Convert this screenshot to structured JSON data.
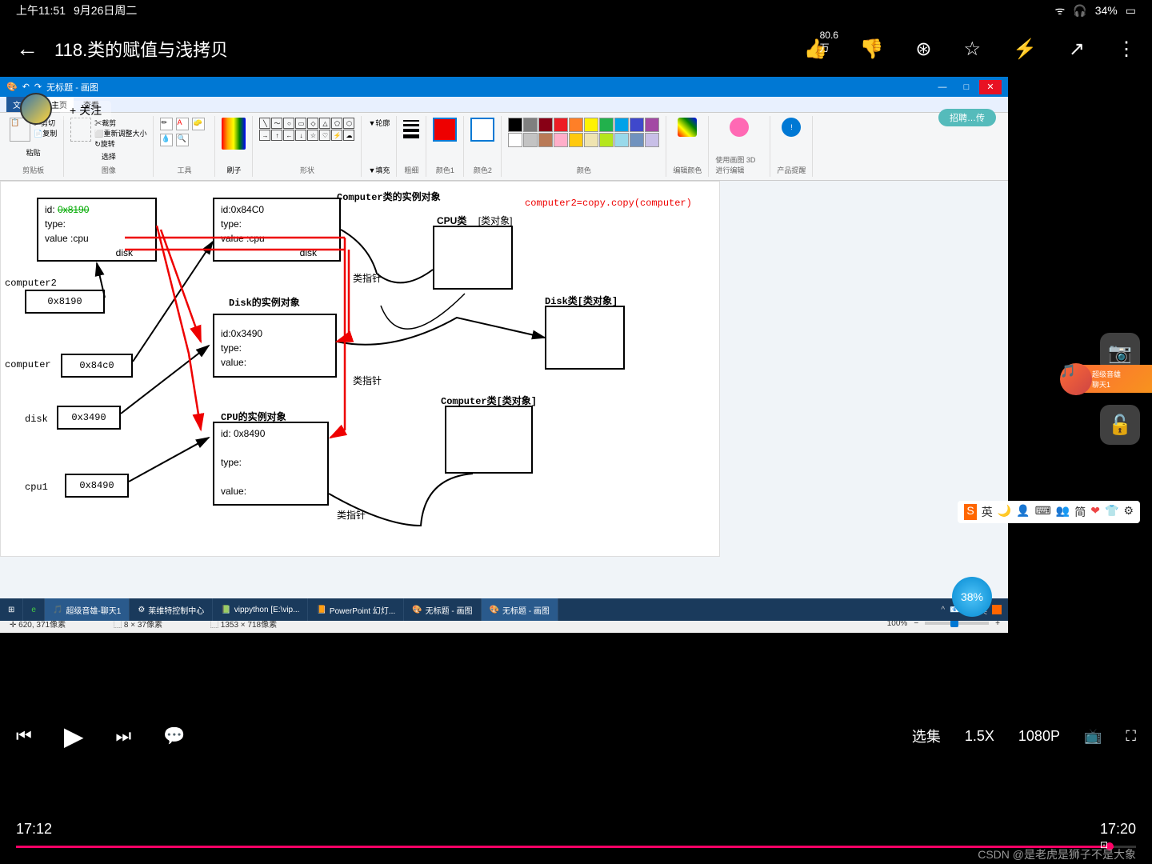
{
  "status": {
    "time": "上午11:51",
    "date": "9月26日周二",
    "battery": "34%"
  },
  "nav": {
    "title": "118.类的赋值与浅拷贝",
    "like_count": "80.6万"
  },
  "paint": {
    "window_title": "无标题 - 画图",
    "menu_file": "文件",
    "menu_home": "主页",
    "menu_view": "查看",
    "follow": "+ 关注",
    "user_badge": "招聘…传",
    "clipboard": "剪贴板",
    "paste": "粘贴",
    "cut": "剪切",
    "copy": "复制",
    "image": "图像",
    "select": "选择",
    "rotate": "旋转",
    "crop": "裁剪",
    "resize": "重新调整大小",
    "tools": "工具",
    "brush": "刷子",
    "shapes": "形状",
    "outline": "轮廓",
    "fill": "填充",
    "thickness": "粗细",
    "color1": "颜色1",
    "color2": "颜色2",
    "colors": "颜色",
    "edit_colors": "编辑颜色",
    "paint3d": "使用画图 3D 进行编辑",
    "product": "产品提醒"
  },
  "diagram": {
    "computer_class_title": "Computer类的实例对象",
    "copy_code": "computer2=copy.copy(computer)",
    "box1_id": "id:",
    "box1_id_val": "0x8190",
    "box1_type": "type:",
    "box1_value": "value :cpu",
    "box1_disk": "disk",
    "box2_id": "id:0x84C0",
    "box2_type": "type:",
    "box2_value": "value :cpu",
    "box2_disk": "disk",
    "cpu_class": "CPU类",
    "class_obj": "[类对象]",
    "disk_class": "Disk类[类对象]",
    "computer_class": "Computer类[类对象]",
    "disk_title": "Disk的实例对象",
    "cpu_title": "CPU的实例对象",
    "disk_id": "id:0x3490",
    "disk_type": "type:",
    "disk_value": "value:",
    "cpu_id": "id: 0x8490",
    "cpu_type": "type:",
    "cpu_value": "value:",
    "ptr": "类指针",
    "computer2_lbl": "computer2",
    "computer2_val": "0x8190",
    "computer_lbl": "computer",
    "computer_val": "0x84c0",
    "disk_lbl": "disk",
    "disk_val": "0x3490",
    "cpu1_lbl": "cpu1",
    "cpu1_val": "0x8490"
  },
  "statusbar": {
    "pos": "620, 371像素",
    "sel": "8 × 37像素",
    "size": "1353 × 718像素",
    "zoom": "100%"
  },
  "taskbar": {
    "t1": "超级音雄-聊天1",
    "t2": "莱维特控制中心",
    "t3": "vippython [E:\\vip...",
    "t4": "PowerPoint 幻灯...",
    "t5": "无标题 - 画图",
    "t6": "无标题 - 画图",
    "ime": "英"
  },
  "progress": {
    "current": "17:12",
    "total": "17:20"
  },
  "controls": {
    "episodes": "选集",
    "speed": "1.5X",
    "quality": "1080P"
  },
  "music": {
    "label": "超级音雄",
    "sub": "聊天1"
  },
  "perf": "38%",
  "watermark": "CSDN @是老虎是狮子不是大象",
  "ime_toolbar": {
    "t1": "英",
    "t2": "简"
  }
}
